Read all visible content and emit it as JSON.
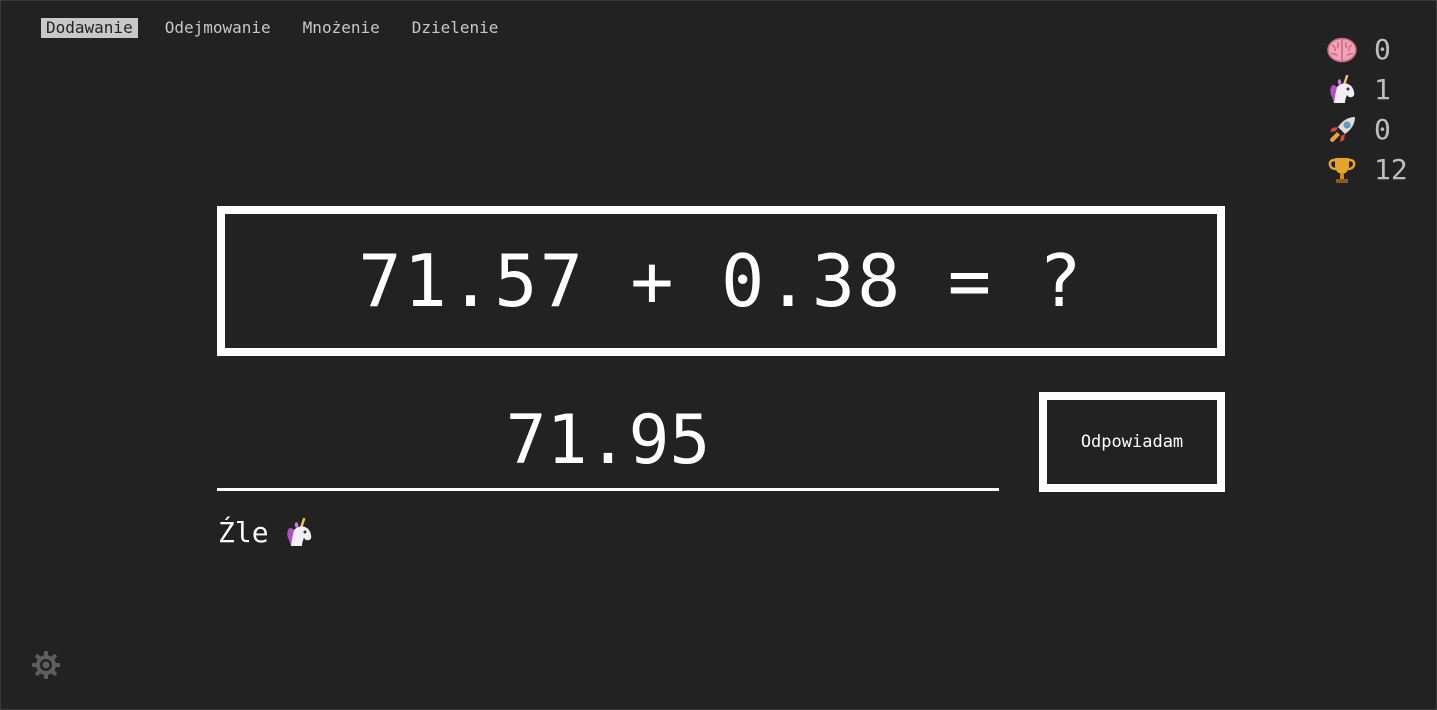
{
  "nav": {
    "tabs": [
      {
        "label": "Dodawanie",
        "active": true
      },
      {
        "label": "Odejmowanie",
        "active": false
      },
      {
        "label": "Mnożenie",
        "active": false
      },
      {
        "label": "Dzielenie",
        "active": false
      }
    ]
  },
  "stats": [
    {
      "icon": "brain-icon",
      "value": "0"
    },
    {
      "icon": "unicorn-icon",
      "value": "1"
    },
    {
      "icon": "rocket-icon",
      "value": "0"
    },
    {
      "icon": "trophy-icon",
      "value": "12"
    }
  ],
  "question": {
    "text": "71.57 + 0.38 = ?"
  },
  "answer": {
    "value": "71.95"
  },
  "submit": {
    "label": "Odpowiadam"
  },
  "feedback": {
    "text": "Źle",
    "icon": "unicorn-icon"
  },
  "settings": {
    "icon": "gear-icon"
  },
  "colors": {
    "background": "#222222",
    "foreground": "#ffffff",
    "muted": "#c8c8c8"
  }
}
